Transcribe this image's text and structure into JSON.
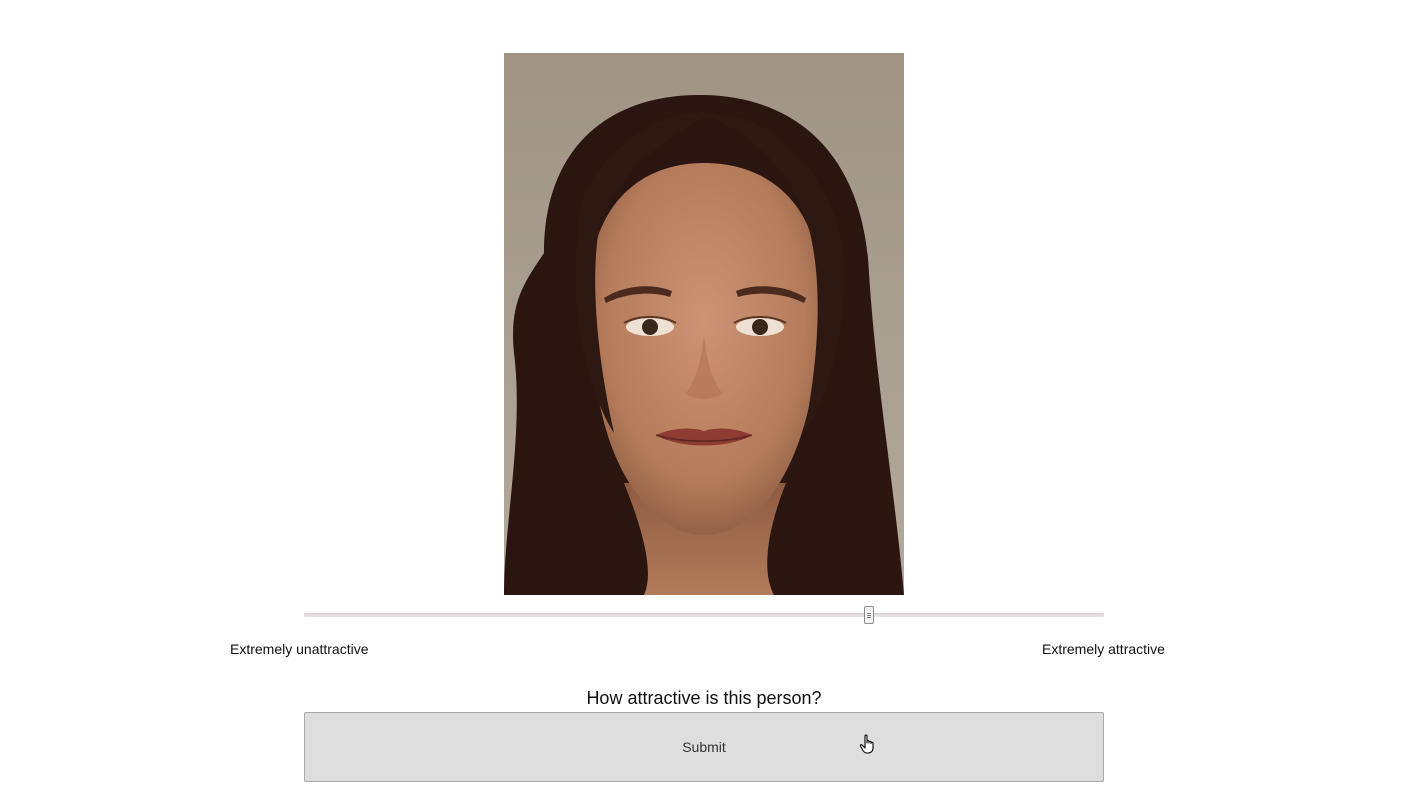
{
  "rating": {
    "question": "How attractive is this person?",
    "scale_min_label": "Extremely unattractive",
    "scale_max_label": "Extremely attractive",
    "slider_value_fraction": 0.706,
    "submit_label": "Submit"
  },
  "icons": {
    "cursor": "hand-pointer-icon",
    "slider_handle": "grip-lines-icon"
  },
  "colors": {
    "page_background": "#ffffff",
    "button_background": "#dedede",
    "photo_background": "#a29889"
  }
}
